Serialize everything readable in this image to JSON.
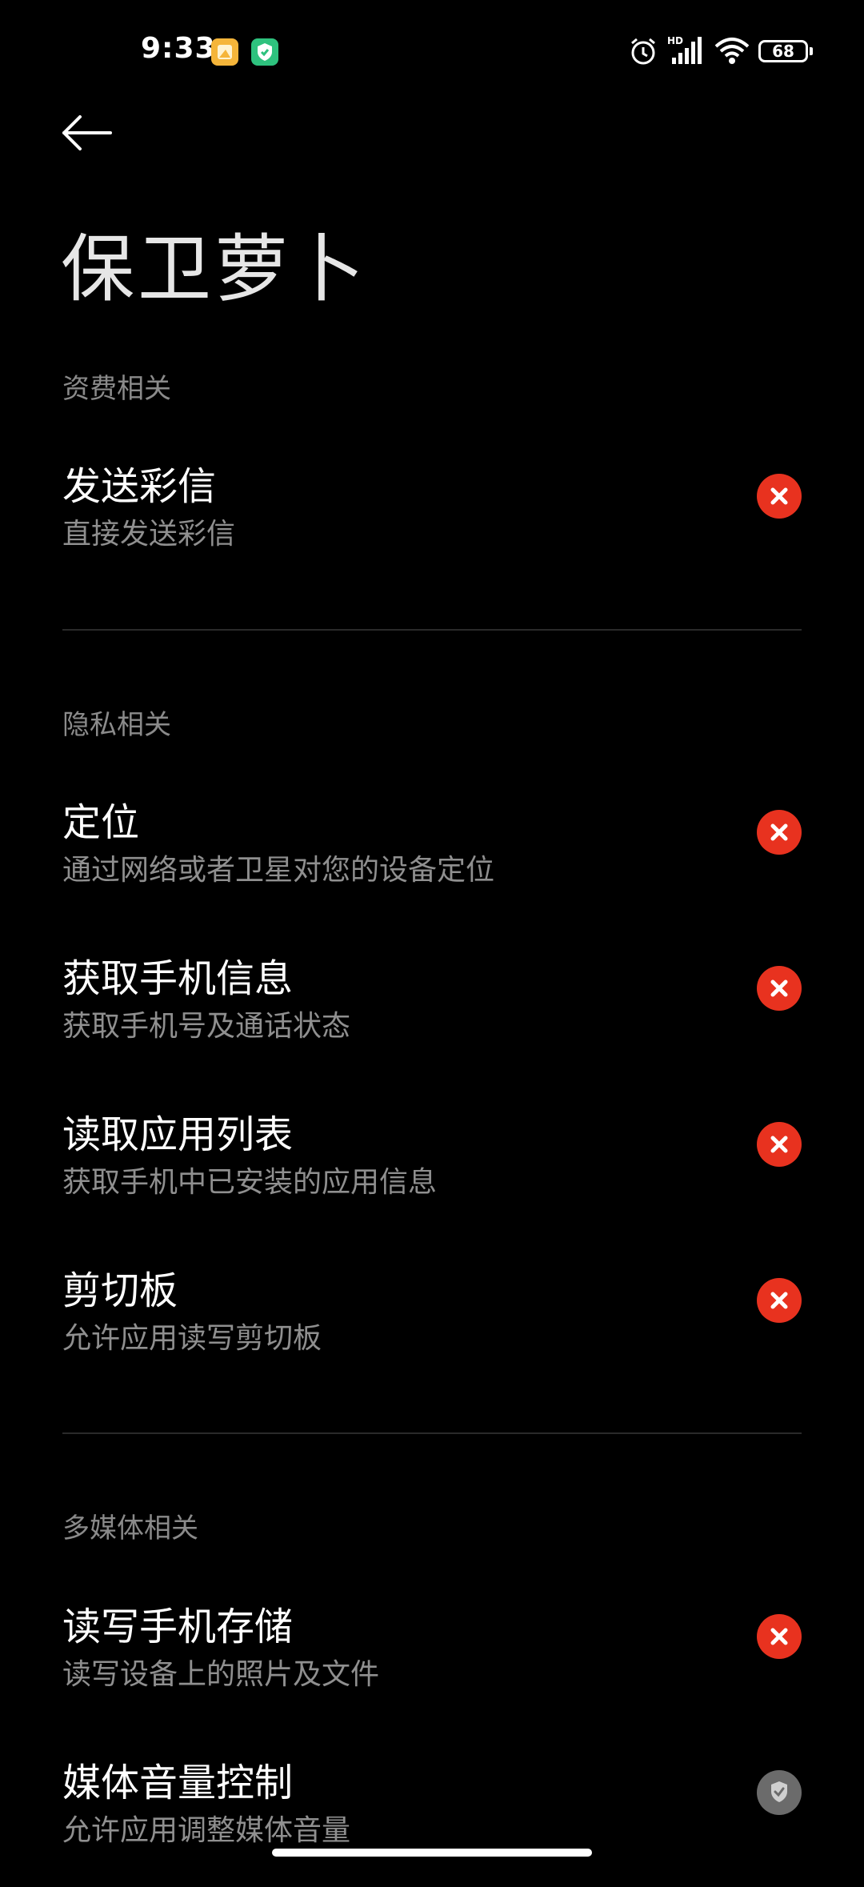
{
  "status_bar": {
    "time": "9:33",
    "battery": "68"
  },
  "header": {
    "title": "保卫萝卜"
  },
  "sections": [
    {
      "header": "资费相关",
      "items": [
        {
          "title": "发送彩信",
          "desc": "直接发送彩信",
          "status": "denied"
        }
      ]
    },
    {
      "header": "隐私相关",
      "items": [
        {
          "title": "定位",
          "desc": "通过网络或者卫星对您的设备定位",
          "status": "denied"
        },
        {
          "title": "获取手机信息",
          "desc": "获取手机号及通话状态",
          "status": "denied"
        },
        {
          "title": "读取应用列表",
          "desc": "获取手机中已安装的应用信息",
          "status": "denied"
        },
        {
          "title": "剪切板",
          "desc": "允许应用读写剪切板",
          "status": "denied"
        }
      ]
    },
    {
      "header": "多媒体相关",
      "items": [
        {
          "title": "读写手机存储",
          "desc": "读写设备上的照片及文件",
          "status": "denied"
        },
        {
          "title": "媒体音量控制",
          "desc": "允许应用调整媒体音量",
          "status": "allowed"
        }
      ]
    }
  ],
  "colors": {
    "denied": "#e8321f",
    "allowed": "#6b6b6b"
  }
}
